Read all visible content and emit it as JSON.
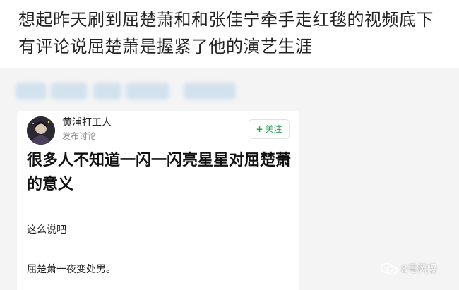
{
  "headline": "想起昨天刷到屈楚萧和和张佳宁牵手走红毯的视频底下有评论说屈楚萧是握紧了他的演艺生涯",
  "post": {
    "author": "黄浦打工人",
    "subtitle": "发布讨论",
    "follow_label": "关注",
    "follow_icon": "+",
    "title": "很多人不知道一闪一闪亮星星对屈楚萧的意义",
    "line1": "这么说吧",
    "line2": "屈楚萧一夜变处男。"
  },
  "watermark": {
    "icon": "wechat-icon",
    "label": "8号风曝"
  },
  "colors": {
    "follow_green": "#2aa35c",
    "page_bg": "#f4f4f4",
    "card_bg": "#ffffff"
  }
}
